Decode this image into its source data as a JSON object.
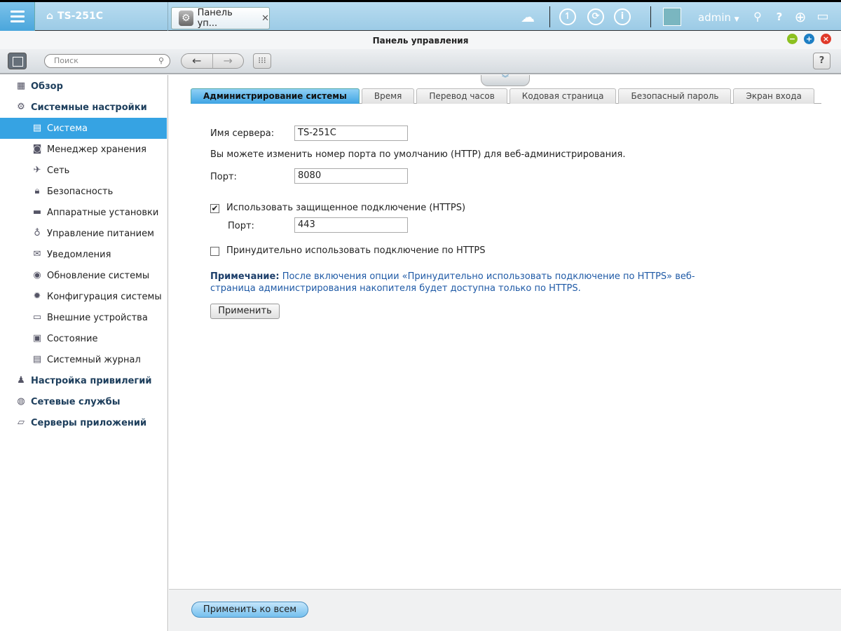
{
  "topbar": {
    "device_name": "TS-251C",
    "app_tab_label": "Панель уп...",
    "user": "admin",
    "icons": [
      "menu-icon",
      "home-icon",
      "cloud-icon",
      "clock-icon",
      "sync-icon",
      "info-icon",
      "avatar",
      "search-icon",
      "help-icon",
      "globe-icon",
      "monitor-icon"
    ]
  },
  "window": {
    "title": "Панель управления",
    "search_placeholder": "Поиск",
    "help_label": "?"
  },
  "sidebar": {
    "items": [
      {
        "label": "Обзор",
        "type": "group",
        "icon": "overview-icon"
      },
      {
        "label": "Системные настройки",
        "type": "group",
        "icon": "gear-icon"
      },
      {
        "label": "Система",
        "type": "sub",
        "icon": "system-icon",
        "active": true
      },
      {
        "label": "Менеджер хранения",
        "type": "sub",
        "icon": "storage-icon"
      },
      {
        "label": "Сеть",
        "type": "sub",
        "icon": "network-icon"
      },
      {
        "label": "Безопасность",
        "type": "sub",
        "icon": "lock-icon"
      },
      {
        "label": "Аппаратные установки",
        "type": "sub",
        "icon": "hardware-icon"
      },
      {
        "label": "Управление питанием",
        "type": "sub",
        "icon": "power-icon"
      },
      {
        "label": "Уведомления",
        "type": "sub",
        "icon": "notification-icon"
      },
      {
        "label": "Обновление системы",
        "type": "sub",
        "icon": "update-icon"
      },
      {
        "label": "Конфигурация системы",
        "type": "sub",
        "icon": "config-icon"
      },
      {
        "label": "Внешние устройства",
        "type": "sub",
        "icon": "external-device-icon"
      },
      {
        "label": "Состояние",
        "type": "sub",
        "icon": "status-icon"
      },
      {
        "label": "Системный журнал",
        "type": "sub",
        "icon": "log-icon"
      },
      {
        "label": "Настройка привилегий",
        "type": "group",
        "icon": "user-icon"
      },
      {
        "label": "Сетевые службы",
        "type": "group",
        "icon": "network-services-icon"
      },
      {
        "label": "Серверы приложений",
        "type": "group",
        "icon": "app-server-icon"
      }
    ]
  },
  "tabs": [
    {
      "label": "Администрирование системы",
      "active": true
    },
    {
      "label": "Время"
    },
    {
      "label": "Перевод часов"
    },
    {
      "label": "Кодовая страница"
    },
    {
      "label": "Безопасный пароль"
    },
    {
      "label": "Экран входа"
    }
  ],
  "form": {
    "server_name_label": "Имя сервера:",
    "server_name_value": "TS-251C",
    "port_hint": "Вы можете изменить номер порта по умолчанию (HTTP) для веб-администрирования.",
    "port_label": "Порт:",
    "port_value": "8080",
    "https_label": "Использовать защищенное подключение (HTTPS)",
    "https_checked": true,
    "https_port_label": "Порт:",
    "https_port_value": "443",
    "force_https_label": "Принудительно использовать подключение по HTTPS",
    "force_https_checked": false,
    "note_title": "Примечание:",
    "note_text": "После включения опции «Принудительно использовать подключение по HTTPS» веб-страница администрирования накопителя будет доступна только по HTTPS.",
    "apply_label": "Применить"
  },
  "footer": {
    "apply_all_label": "Применить ко всем"
  }
}
